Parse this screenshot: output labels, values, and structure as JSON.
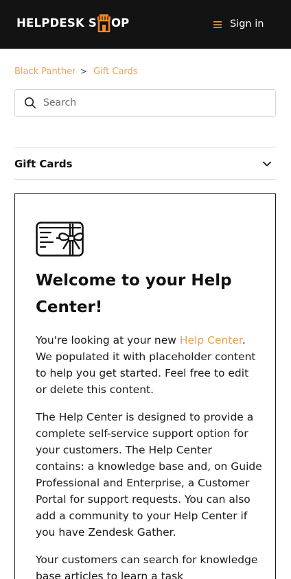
{
  "header": {
    "logo": {
      "text_left": "HELPDESK S",
      "text_right": "OP",
      "accent": "#f08a24"
    },
    "menu_icon": "hamburger-menu-icon",
    "signin_label": "Sign in"
  },
  "breadcrumbs": {
    "items": [
      "Black Panther",
      "Gift Cards"
    ],
    "separator": ">"
  },
  "search": {
    "placeholder": "Search",
    "icon": "search-icon"
  },
  "section": {
    "title": "Gift Cards",
    "toggle_icon": "chevron-down-icon"
  },
  "article": {
    "icon": "gift-card-icon",
    "title": "Welcome to your Help Center!",
    "p1_before": "You're looking at your new ",
    "p1_link": "Help Center",
    "p1_after": ". We populated it with placeholder content to help you get started. Feel free to edit or delete this content.",
    "p2": "The Help Center is designed to provide a complete self-service support option for your customers. The Help Center contains: a knowledge base and, on Guide Professional and Enterprise, a Customer Portal for support requests. You can also add a community to your Help Center if you have Zendesk Gather.",
    "p3": "Your customers can search for knowledge base articles to learn a task"
  },
  "colors": {
    "topbar_bg": "#131313",
    "accent": "#e8a25a",
    "logo_accent": "#f08a24"
  }
}
